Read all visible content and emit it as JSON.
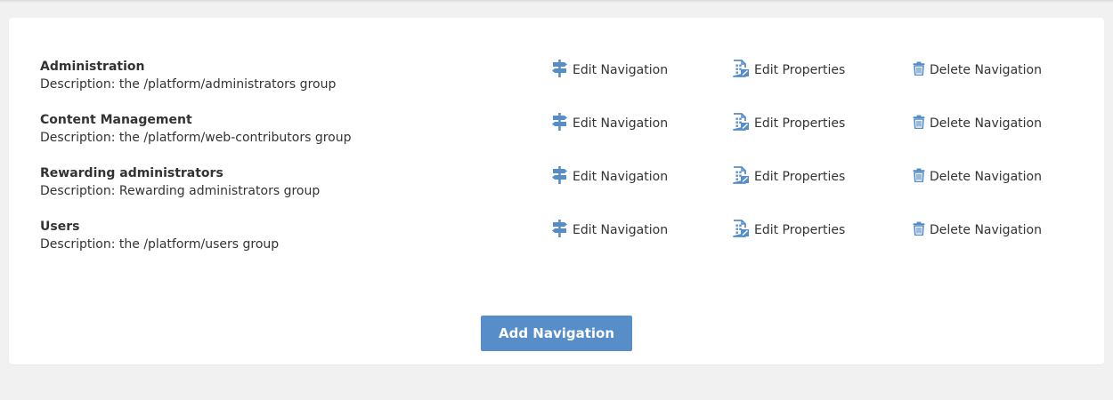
{
  "groups": [
    {
      "title": "Administration",
      "description": "Description: the /platform/administrators group"
    },
    {
      "title": "Content Management",
      "description": "Description: the /platform/web-contributors group"
    },
    {
      "title": "Rewarding administrators",
      "description": "Description: Rewarding administrators group"
    },
    {
      "title": "Users",
      "description": "Description: the /platform/users group"
    }
  ],
  "actions": {
    "edit_navigation": "Edit Navigation",
    "edit_properties": "Edit Properties",
    "delete_navigation": "Delete Navigation"
  },
  "icons": {
    "edit_navigation": "signpost-icon",
    "edit_properties": "edit-document-icon",
    "delete_navigation": "trash-icon"
  },
  "add_button_label": "Add Navigation",
  "colors": {
    "accent": "#578dc9",
    "background": "#f1f1f1",
    "panel": "#ffffff",
    "text": "#333333"
  }
}
